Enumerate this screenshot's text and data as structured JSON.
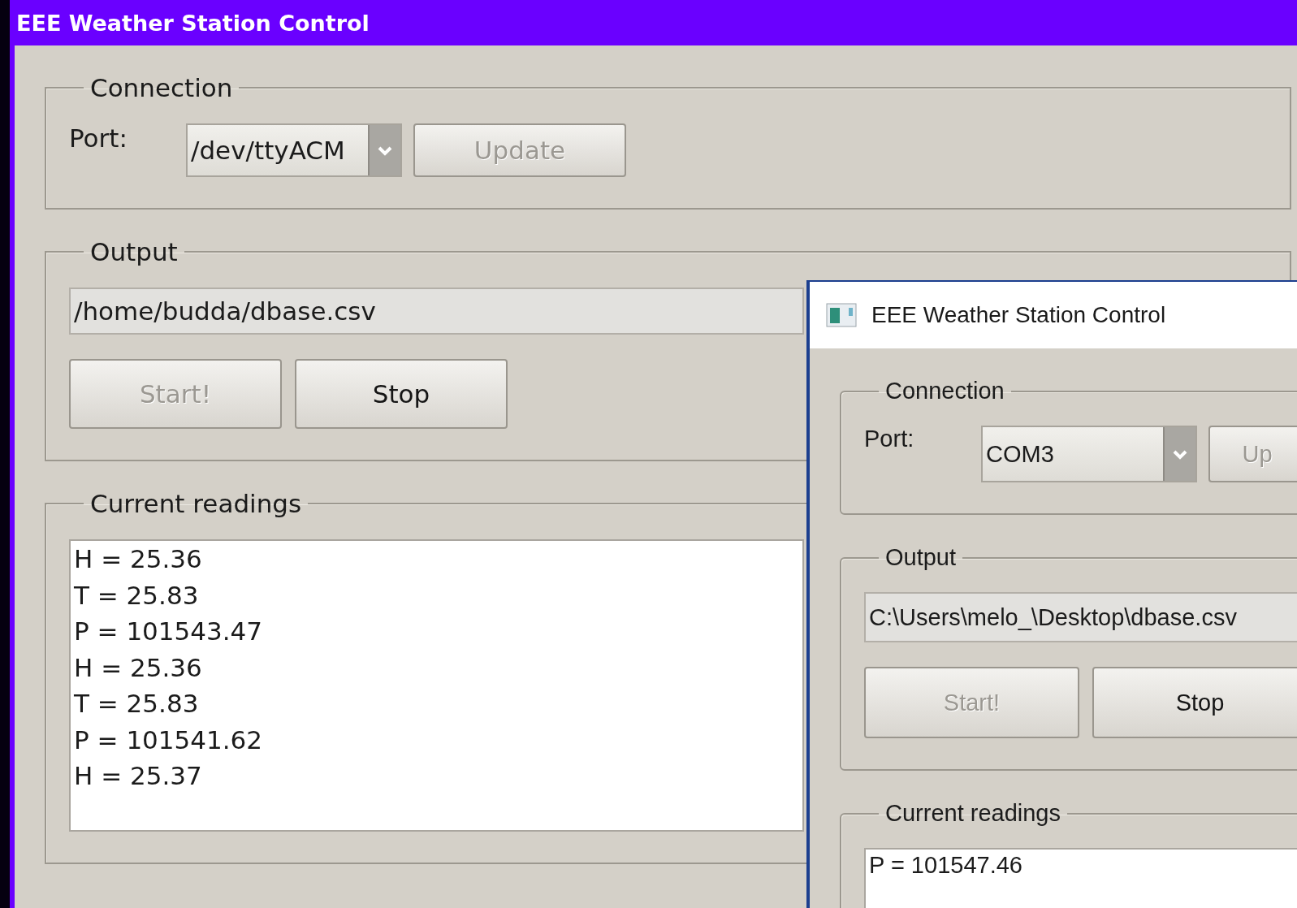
{
  "windows": [
    {
      "kind": "linux",
      "title": "EEE Weather Station Control",
      "connection": {
        "title": "Connection",
        "port_label": "Port:",
        "port_value": "/dev/ttyACM",
        "update_button": {
          "label": "Update",
          "disabled": true
        }
      },
      "output": {
        "title": "Output",
        "path": "/home/budda/dbase.csv",
        "start_button": {
          "label": "Start!",
          "disabled": true
        },
        "stop_button": {
          "label": "Stop",
          "disabled": false
        }
      },
      "readings": {
        "title": "Current readings",
        "lines": [
          "H = 25.36",
          "T = 25.83",
          "P = 101543.47",
          "H = 25.36",
          "T = 25.83",
          "P = 101541.62",
          "H = 25.37"
        ]
      }
    },
    {
      "kind": "windows",
      "title": "EEE Weather Station Control",
      "connection": {
        "title": "Connection",
        "port_label": "Port:",
        "port_value": "COM3",
        "update_button": {
          "label": "Up",
          "disabled": true
        }
      },
      "output": {
        "title": "Output",
        "path": "C:\\Users\\melo_\\Desktop\\dbase.csv",
        "start_button": {
          "label": "Start!",
          "disabled": true
        },
        "stop_button": {
          "label": "Stop",
          "disabled": false
        }
      },
      "readings": {
        "title": "Current readings",
        "lines": [
          "P = 101547.46"
        ]
      }
    }
  ]
}
